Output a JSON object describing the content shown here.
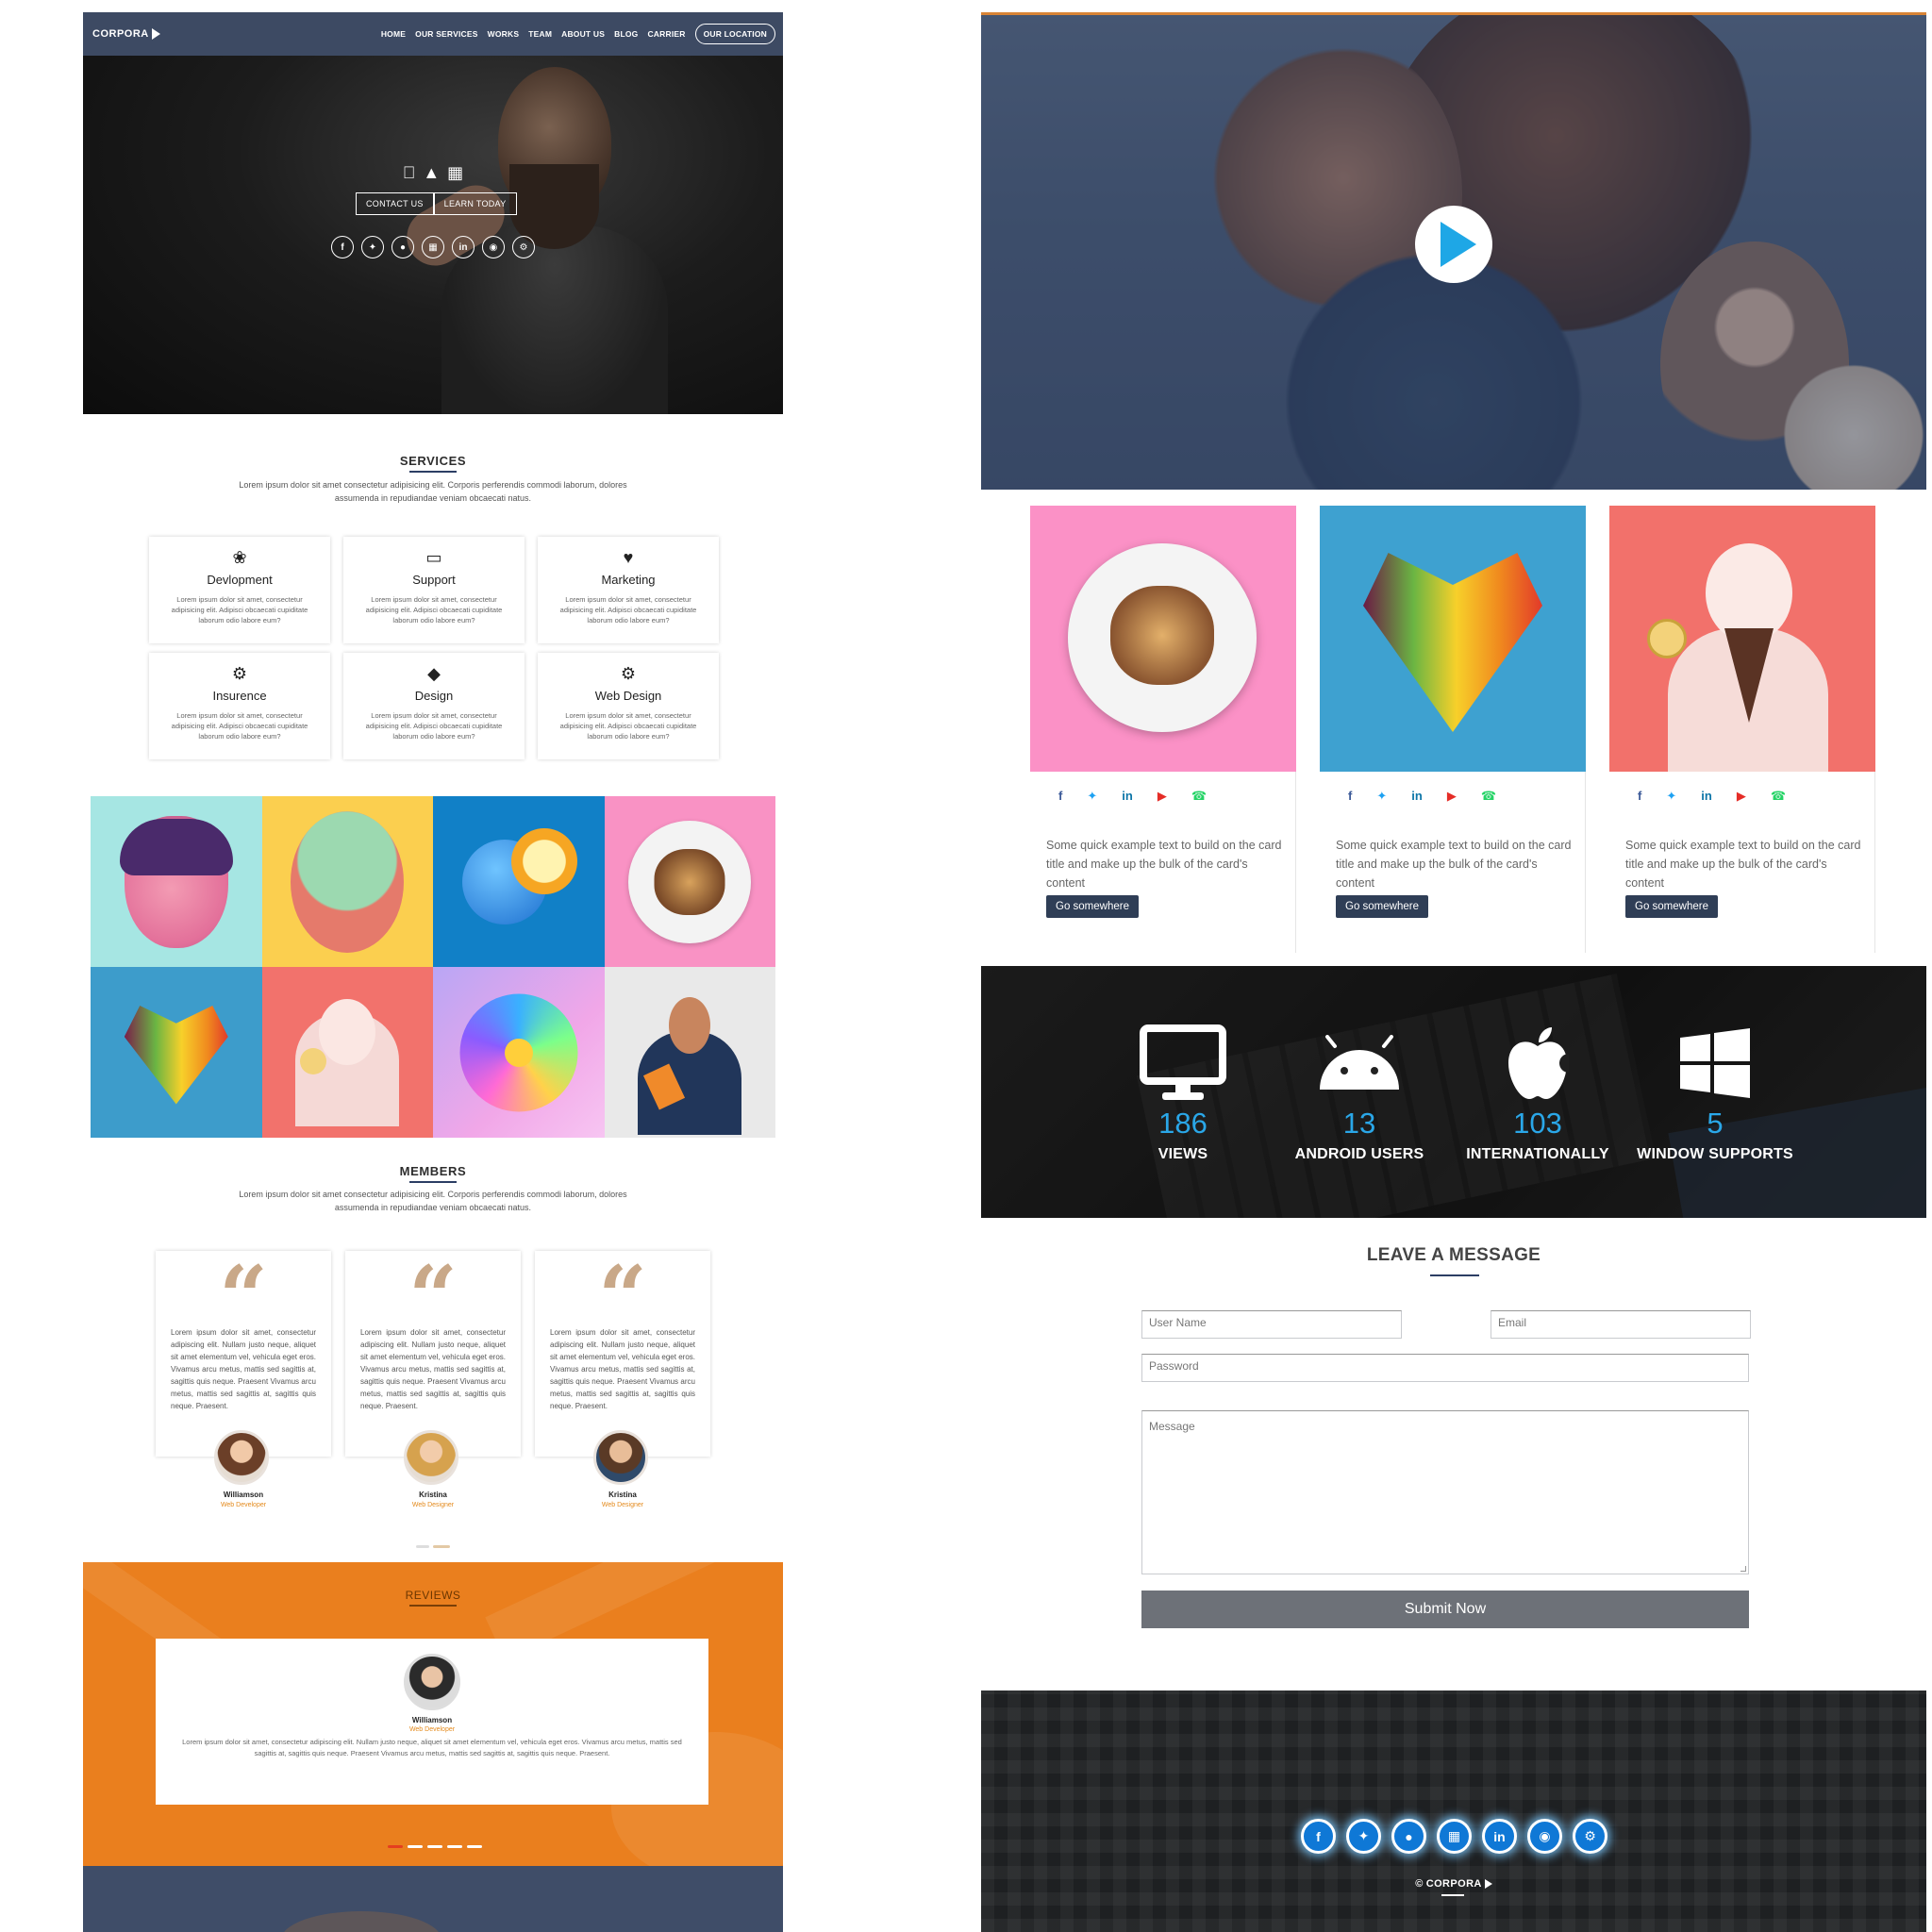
{
  "left": {
    "brand": "CORPORA",
    "nav": [
      "HOME",
      "OUR SERVICES",
      "WORKS",
      "TEAM",
      "ABOUT US",
      "BLOG",
      "CARRIER"
    ],
    "nav_cta": "OUR LOCATION",
    "hero": {
      "os_icons": [
        "apple-icon",
        "android-icon",
        "windows-icon"
      ],
      "buttons": [
        "CONTACT US",
        "LEARN TODAY"
      ],
      "socials": [
        "facebook-icon",
        "twitter-icon",
        "reddit-icon",
        "windows-icon",
        "linkedin-icon",
        "dribbble-icon",
        "gear-icon"
      ]
    },
    "services": {
      "title": "SERVICES",
      "description": "Lorem ipsum dolor sit amet consectetur adipisicing elit. Corporis perferendis commodi laborum, dolores assumenda in repudiandae veniam obcaecati natus.",
      "items": [
        {
          "icon": "leaf-icon",
          "title": "Devlopment",
          "text": "Lorem ipsum dolor sit amet, consectetur adipisicing elit. Adipisci obcaecati cupiditate laborum odio labore eum?"
        },
        {
          "icon": "laptop-icon",
          "title": "Support",
          "text": "Lorem ipsum dolor sit amet, consectetur adipisicing elit. Adipisci obcaecati cupiditate laborum odio labore eum?"
        },
        {
          "icon": "heart-icon",
          "title": "Marketing",
          "text": "Lorem ipsum dolor sit amet, consectetur adipisicing elit. Adipisci obcaecati cupiditate laborum odio labore eum?"
        },
        {
          "icon": "cogs-icon",
          "title": "Insurence",
          "text": "Lorem ipsum dolor sit amet, consectetur adipisicing elit. Adipisci obcaecati cupiditate laborum odio labore eum?"
        },
        {
          "icon": "gem-icon",
          "title": "Design",
          "text": "Lorem ipsum dolor sit amet, consectetur adipisicing elit. Adipisci obcaecati cupiditate laborum odio labore eum?"
        },
        {
          "icon": "gear-icon",
          "title": "Web Design",
          "text": "Lorem ipsum dolor sit amet, consectetur adipisicing elit. Adipisci obcaecati cupiditate laborum odio labore eum?"
        }
      ]
    },
    "members": {
      "title": "MEMBERS",
      "description": "Lorem ipsum dolor sit amet consectetur adipisicing elit. Corporis perferendis commodi laborum, dolores assumenda in repudiandae veniam obcaecati natus.",
      "quote_text": "Lorem ipsum dolor sit amet, consectetur adipiscing elit. Nullam justo neque, aliquet sit amet elementum vel, vehicula eget eros. Vivamus arcu metus, mattis sed sagittis at, sagittis quis neque. Praesent Vivamus arcu metus, mattis sed sagittis at, sagittis quis neque. Praesent.",
      "items": [
        {
          "name": "Williamson",
          "role": "Web Developer"
        },
        {
          "name": "Kristina",
          "role": "Web Designer"
        },
        {
          "name": "Kristina",
          "role": "Web Designer"
        }
      ]
    },
    "reviews": {
      "title": "REVIEWS",
      "name": "Williamson",
      "role": "Web Developer",
      "text": "Lorem ipsum dolor sit amet, consectetur adipiscing elit. Nullam justo neque, aliquet sit amet elementum vel, vehicula eget eros. Vivamus arcu metus, mattis sed sagittis at, sagittis quis neque. Praesent Vivamus arcu metus, mattis sed sagittis at, sagittis quis neque. Praesent."
    }
  },
  "right": {
    "cards": [
      {
        "text": "Some quick example text to build on the card title and make up the bulk of the card's content",
        "button": "Go somewhere"
      },
      {
        "text": "Some quick example text to build on the card title and make up the bulk of the card's content",
        "button": "Go somewhere"
      },
      {
        "text": "Some quick example text to build on the card title and make up the bulk of the card's content",
        "button": "Go somewhere"
      }
    ],
    "card_socials": [
      "facebook-icon",
      "twitter-icon",
      "linkedin-icon",
      "youtube-icon",
      "whatsapp-icon"
    ],
    "stats": [
      {
        "icon": "monitor-icon",
        "value": "186",
        "label": "VIEWS"
      },
      {
        "icon": "android-icon",
        "value": "13",
        "label": "ANDROID USERS"
      },
      {
        "icon": "apple-icon",
        "value": "103",
        "label": "INTERNATIONALLY"
      },
      {
        "icon": "windows-icon",
        "value": "5",
        "label": "WINDOW SUPPORTS"
      }
    ],
    "contact": {
      "title": "LEAVE A MESSAGE",
      "username_placeholder": "User Name",
      "email_placeholder": "Email",
      "password_placeholder": "Password",
      "message_placeholder": "Message",
      "submit": "Submit Now"
    },
    "footer": {
      "socials": [
        "facebook-icon",
        "twitter-icon",
        "reddit-icon",
        "windows-icon",
        "linkedin-icon",
        "dribbble-icon",
        "gear-icon"
      ],
      "brand": "CORPORA"
    }
  },
  "colors": {
    "accent_blue": "#2aa7e8",
    "navy": "#3d4a63",
    "orange": "#ea7f1e",
    "quote_tan": "#c9a888",
    "role_orange": "#e48a1c"
  }
}
